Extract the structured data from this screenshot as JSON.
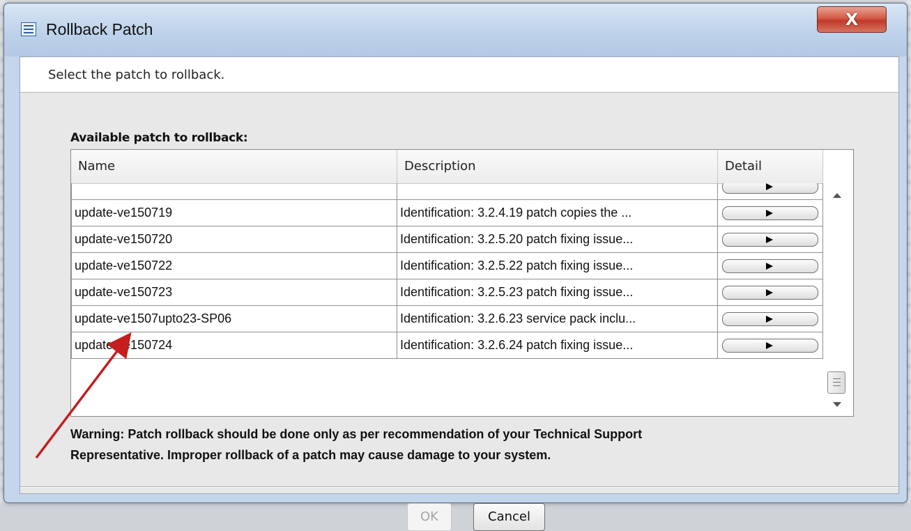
{
  "window": {
    "title": "Rollback Patch",
    "close_glyph": "X"
  },
  "header": {
    "instruction": "Select the patch to rollback."
  },
  "table": {
    "label": "Available patch to rollback:",
    "columns": [
      "Name",
      "Description",
      "Detail"
    ],
    "rows": [
      {
        "name": "update-ve150719",
        "description": "Identification: 3.2.4.19 patch copies the ..."
      },
      {
        "name": "update-ve150720",
        "description": "Identification: 3.2.5.20 patch fixing issue..."
      },
      {
        "name": "update-ve150722",
        "description": "Identification: 3.2.5.22 patch fixing issue..."
      },
      {
        "name": "update-ve150723",
        "description": "Identification: 3.2.5.23 patch fixing issue..."
      },
      {
        "name": "update-ve1507upto23-SP06",
        "description": "Identification: 3.2.6.23 service pack inclu..."
      },
      {
        "name": "update-ve150724",
        "description": "Identification: 3.2.6.24 patch fixing issue..."
      }
    ]
  },
  "warning": {
    "line1": "Warning: Patch rollback should be done only as per recommendation of your Technical Support",
    "line2": "Representative. Improper rollback of a patch may cause damage to your system."
  },
  "buttons": {
    "ok": "OK",
    "cancel": "Cancel"
  },
  "icons": {
    "app": "dialog-window-icon",
    "close": "close-icon",
    "detail": "play-arrow-icon",
    "scroll_up": "scroll-up-arrow-icon",
    "scroll_down": "scroll-down-arrow-icon",
    "annotation": "red-annotation-arrow"
  },
  "colors": {
    "annotation_arrow": "#c41e1e",
    "close_button": "#c0392b"
  }
}
